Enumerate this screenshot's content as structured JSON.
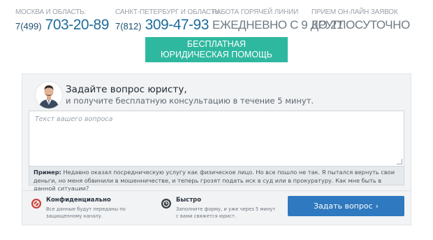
{
  "header": {
    "moscow": {
      "caption": "Москва и область:",
      "prefix": "7(499)",
      "number": "703-20-89"
    },
    "spb": {
      "caption": "Санкт-Петербург и область:",
      "prefix": "7(812)",
      "number": "309-47-93"
    },
    "hotline": {
      "caption": "Работа горячей линии",
      "value": "Ежедневно с 9 до 21"
    },
    "online": {
      "caption": "Прием он-лайн заявок",
      "value": "Круглосуточно"
    }
  },
  "cta": {
    "label": "Бесплатная юридическая помощь"
  },
  "form": {
    "title": "Задайте вопрос юристу,",
    "subtitle": "и получите бесплатную консультацию в течение 5 минут.",
    "textarea_placeholder": "Текст вашего вопроса",
    "textarea_value": "",
    "example_label": "Пример:",
    "example_text": "Недавно оказал посредническую услугу как физическое лицо. Но все пошло не так. Я пытался вернуть свои деньги, но меня обвинили в мошенничестве, и теперь грозят подать иск в суд или в прокуратуру. Как мне быть в данной ситуации?",
    "features": [
      {
        "title": "Конфиденциально",
        "line1": "Все данные будут переданы по",
        "line2": "защищенному каналу.",
        "icon": "shield-icon",
        "color": "#c8423a"
      },
      {
        "title": "Быстро",
        "line1": "Заполните форму, и уже через 5 минут",
        "line2": "с вами свяжется юрист.",
        "icon": "timer-icon",
        "color": "#3a3f44"
      }
    ],
    "submit_label": "Задать вопрос",
    "submit_arrow": "›"
  },
  "colors": {
    "cta": "#2fb8a0",
    "submit": "#2e79bf",
    "phone": "#1e6c9c"
  }
}
